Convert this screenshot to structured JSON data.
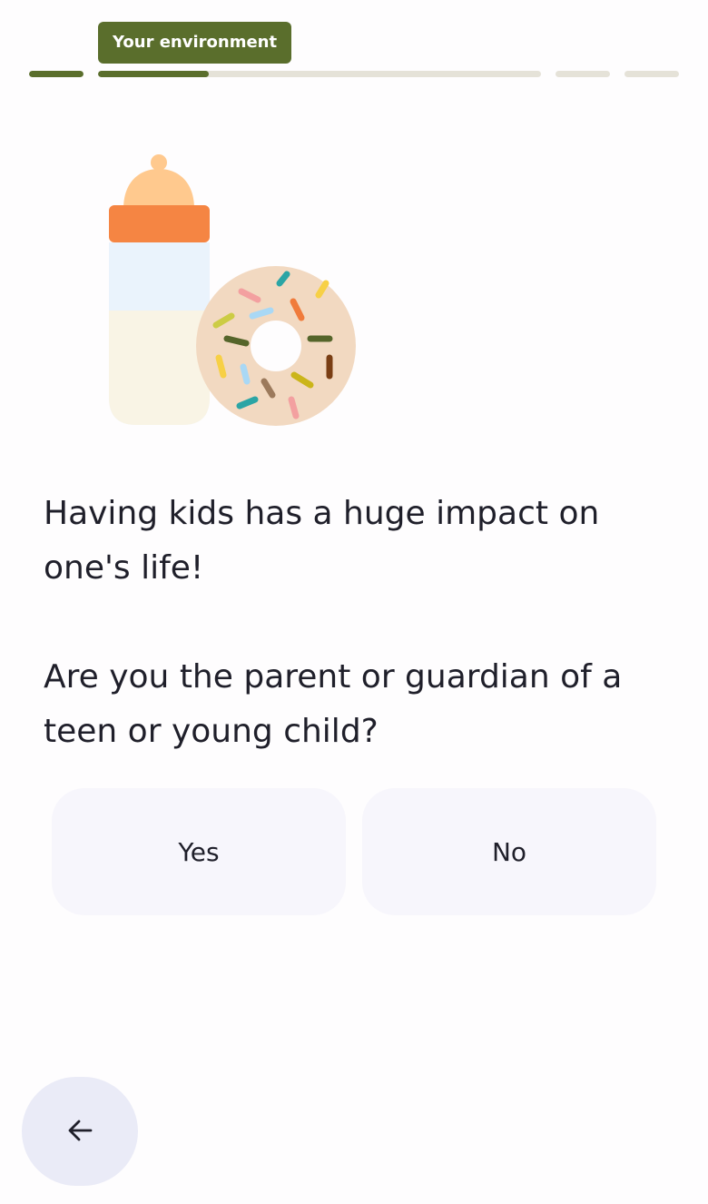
{
  "progress": {
    "current_step_label": "Your environment",
    "segments": [
      {
        "name": "step-1",
        "fill": 1.0
      },
      {
        "name": "step-2",
        "fill": 0.25
      },
      {
        "name": "step-3",
        "fill": 0.0
      },
      {
        "name": "step-4",
        "fill": 0.0
      }
    ]
  },
  "illustration": {
    "icons": [
      "baby-bottle-icon",
      "sprinkled-donut-icon"
    ]
  },
  "question": {
    "intro": "Having kids has a huge impact on one's life!",
    "prompt": "Are you the parent or guardian of a teen or young child?"
  },
  "answers": {
    "yes_label": "Yes",
    "no_label": "No"
  },
  "navigation": {
    "back_icon": "arrow-left-icon"
  },
  "colors": {
    "accent": "#5a6e2c",
    "track": "#e5e2d8",
    "answer_bg": "#f7f6fc",
    "back_bg": "#eaebf7",
    "text": "#1f1f2a"
  }
}
